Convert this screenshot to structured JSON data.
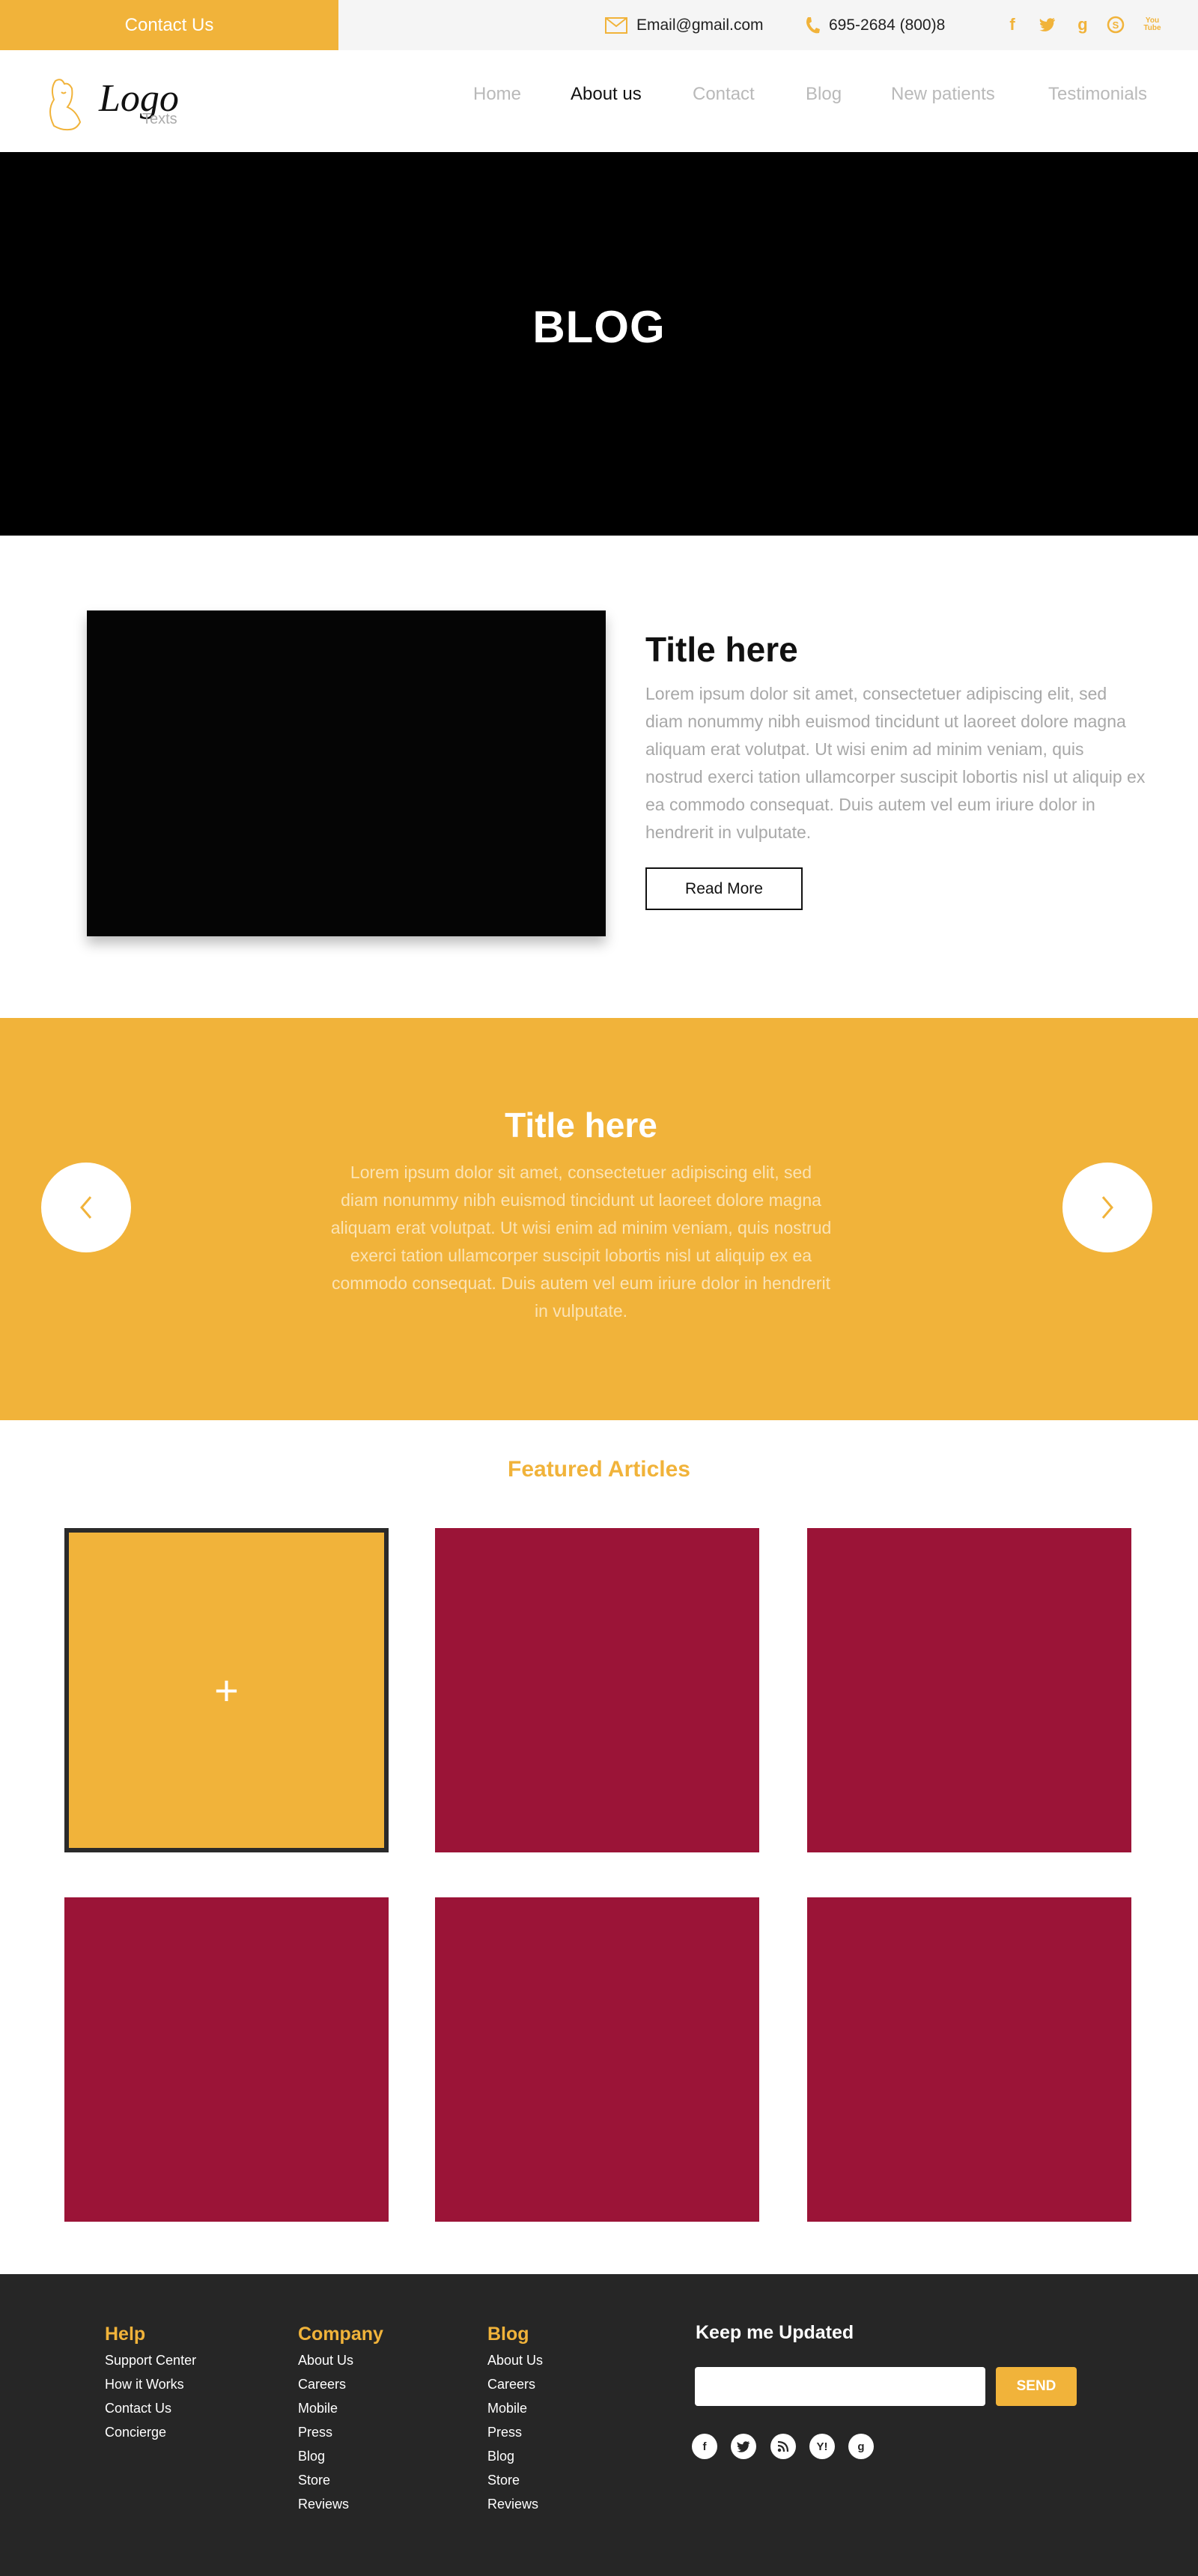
{
  "topbar": {
    "contact_tab": "Contact Us",
    "email": "Email@gmail.com",
    "phone": "695-2684 (800)8",
    "social": [
      {
        "icon": "facebook-icon",
        "glyph": "f"
      },
      {
        "icon": "twitter-icon",
        "glyph": "🐦"
      },
      {
        "icon": "google-icon",
        "glyph": "g"
      },
      {
        "icon": "skype-icon",
        "glyph": "S"
      },
      {
        "icon": "youtube-icon",
        "glyph": "You Tube"
      }
    ]
  },
  "header": {
    "logo_text": "Logo",
    "logo_subtext": "Texts",
    "nav": [
      "Home",
      "About us",
      "Contact",
      "Blog",
      "New patients",
      "Testimonials"
    ],
    "active_nav": "About us"
  },
  "hero": {
    "title": "BLOG"
  },
  "post": {
    "title": "Title here",
    "body": "Lorem ipsum dolor sit amet, consectetuer adipiscing elit, sed diam nonummy nibh euismod tincidunt ut laoreet dolore magna aliquam erat volutpat. Ut wisi enim ad minim veniam, quis nostrud exerci tation ullamcorper suscipit lobortis nisl ut aliquip ex ea commodo consequat. Duis autem vel eum iriure dolor in hendrerit in vulputate.",
    "button": "Read More"
  },
  "slider": {
    "title": "Title here",
    "body": "Lorem ipsum dolor sit amet, consectetuer adipiscing elit, sed diam nonummy nibh euismod tincidunt ut laoreet dolore magna aliquam erat volutpat. Ut wisi enim ad minim veniam, quis nostrud exerci tation ullamcorper suscipit lobortis nisl ut aliquip ex ea commodo consequat. Duis autem vel eum iriure dolor in hendrerit in vulputate.",
    "prev_icon": "chevron-left-icon",
    "next_icon": "chevron-right-icon"
  },
  "featured": {
    "heading": "Featured Articles",
    "plus": "+"
  },
  "footer": {
    "help": {
      "title": "Help",
      "items": [
        "Support Center",
        "How it Works",
        "Contact Us",
        "Concierge"
      ]
    },
    "company": {
      "title": "Company",
      "items": [
        "About Us",
        "Careers",
        "Mobile",
        "Press",
        "Blog",
        "Store",
        "Reviews"
      ]
    },
    "blog": {
      "title": "Blog",
      "items": [
        "About Us",
        "Careers",
        "Mobile",
        "Press",
        "Blog",
        "Store",
        "Reviews"
      ]
    },
    "newsletter": {
      "title": "Keep me Updated",
      "placeholder": "",
      "button": "SEND"
    },
    "social": [
      {
        "icon": "facebook-icon",
        "glyph": "f"
      },
      {
        "icon": "twitter-icon",
        "glyph": "t"
      },
      {
        "icon": "rss-icon",
        "glyph": "r"
      },
      {
        "icon": "yahoo-icon",
        "glyph": "Y!"
      },
      {
        "icon": "google-icon",
        "glyph": "g"
      }
    ]
  },
  "colors": {
    "accent": "#f1b33a",
    "card": "#9b1437",
    "footer": "#262626"
  }
}
